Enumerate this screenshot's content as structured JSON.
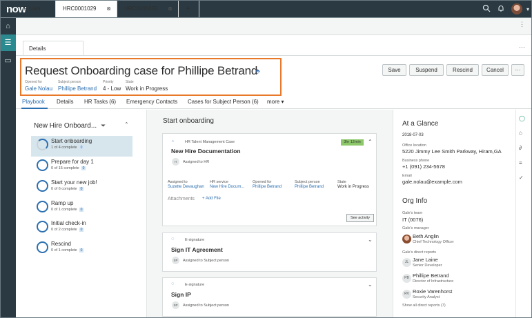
{
  "app": {
    "logo": "now"
  },
  "topbar": {
    "icons": [
      "search-icon",
      "chat-icon",
      "bell-icon"
    ]
  },
  "workspace_tabs": {
    "lists": "Lists",
    "tab1": "HRC0001029",
    "tab2": "HRC0001035",
    "add": "+"
  },
  "subtab": {
    "label": "Details"
  },
  "record": {
    "title": "Request Onboarding case for Phillipe Betrand",
    "opened_for_label": "Opened for",
    "opened_for": "Gale Nolau",
    "subject_label": "Subject person",
    "subject": "Phillipe Betrand",
    "priority_label": "Priority",
    "priority": "4 - Low",
    "state_label": "State",
    "state": "Work in Progress"
  },
  "actions": {
    "save": "Save",
    "suspend": "Suspend",
    "rescind": "Rescind",
    "cancel": "Cancel",
    "more": "···"
  },
  "record_tabs": {
    "playbook": "Playbook",
    "details": "Details",
    "hr_tasks": "HR Tasks (6)",
    "emergency": "Emergency Contacts",
    "cases": "Cases for Subject Person (6)",
    "more": "more ▾"
  },
  "playbook": {
    "title": "New Hire Onboard...",
    "steps": [
      {
        "name": "Start onboarding",
        "sub": "1 of 4 complete",
        "badge": "0"
      },
      {
        "name": "Prepare for day 1",
        "sub": "0 of 15 complete",
        "badge": "0"
      },
      {
        "name": "Start your new job!",
        "sub": "0 of 6 complete",
        "badge": "0"
      },
      {
        "name": "Ramp up",
        "sub": "0 of 1 complete",
        "badge": "0"
      },
      {
        "name": "Initial check-in",
        "sub": "0 of 2 complete",
        "badge": "0"
      },
      {
        "name": "Rescind",
        "sub": "0 of 1 complete",
        "badge": "0"
      }
    ]
  },
  "main": {
    "title": "Start onboarding",
    "card1": {
      "type": "HR Talent Management Case",
      "timer": "3hr 12min",
      "title": "New Hire Documentation",
      "assigned": "Assigned to HR",
      "pill": "H",
      "assigned_to_label": "Assigned to",
      "assigned_to": "Suzette Devaughan",
      "hr_service_label": "HR service",
      "hr_service": "New Hire Docum...",
      "opened_for_label": "Opened for",
      "opened_for": "Phillipe Betrand",
      "subject_label": "Subject person",
      "subject": "Phillipe Betrand",
      "state_label": "State",
      "state": "Work in Progress",
      "attachments": "Attachments",
      "add_file": "+ Add File",
      "see_activity": "See activity"
    },
    "card2": {
      "type": "E-signature",
      "title": "Sign IT Agreement",
      "pill": "SP",
      "assigned": "Assigned to Subject person"
    },
    "card3": {
      "type": "E-signature",
      "title": "Sign IP",
      "pill": "SP",
      "assigned": "Assigned to Subject person"
    }
  },
  "glance": {
    "title": "At a Glance",
    "date": "2018-07-03",
    "office_label": "Office location",
    "office": "5220 Jimmy Lee Smith Parkway, Hiram,GA",
    "phone_label": "Business phone",
    "phone": "+1 (091) 234-5678",
    "email_label": "Email",
    "email": "gale.nolau@example.com",
    "org_title": "Org Info",
    "team_label": "Gale's team",
    "team": "IT (0076)",
    "manager_label": "Gale's manager",
    "manager": "Beth Anglin",
    "manager_role": "Chief Technology Officer",
    "reports_label": "Gale's direct reports",
    "reports": [
      {
        "initials": "JL",
        "name": "Jane Laine",
        "role": "Senior Developer"
      },
      {
        "initials": "PB",
        "name": "Phillipe Betrand",
        "role": "Director of Infrastructure"
      },
      {
        "initials": "RV",
        "name": "Roxie Varenhorst",
        "role": "Security Analyst"
      }
    ],
    "show_all": "Show all direct reports (7)"
  }
}
